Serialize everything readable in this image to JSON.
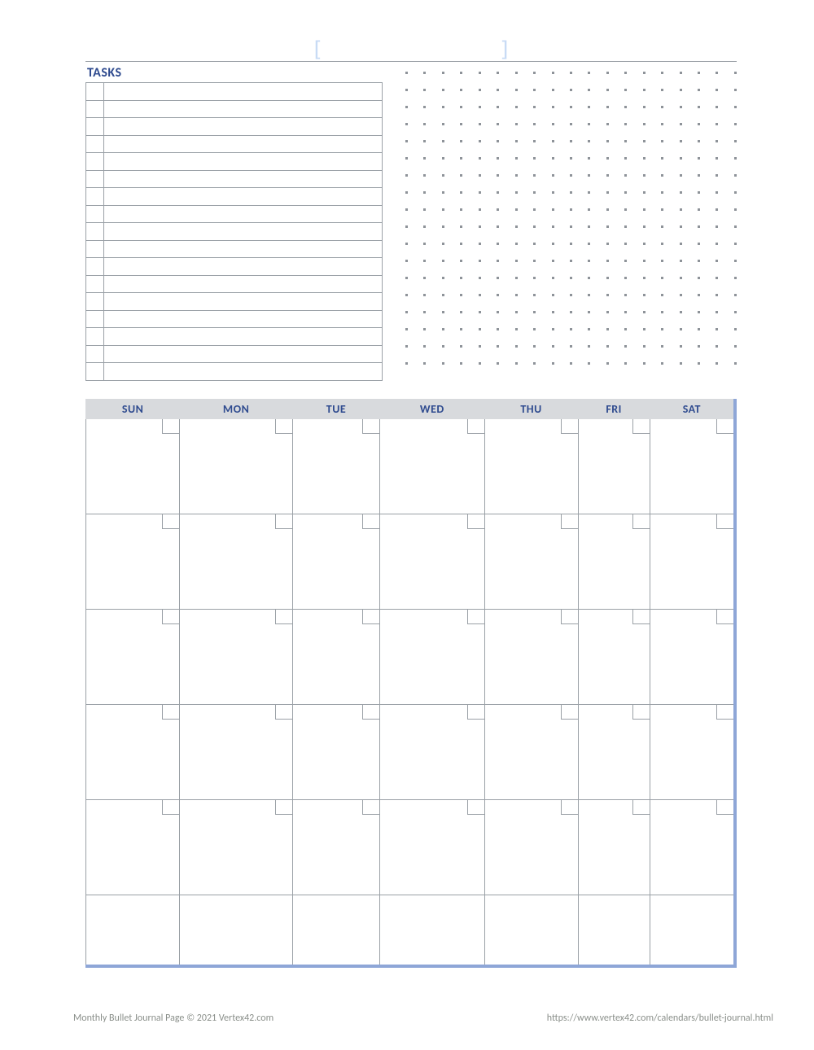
{
  "header": {
    "left_bracket": "[",
    "right_bracket": "]"
  },
  "tasks": {
    "heading": "TASKS",
    "row_count": 17
  },
  "dotgrid": {
    "rows": 18,
    "cols": 19
  },
  "calendar": {
    "day_headers": [
      "SUN",
      "MON",
      "TUE",
      "WED",
      "THU",
      "FRI",
      "SAT"
    ],
    "weeks": 6
  },
  "footer": {
    "left": "Monthly Bullet Journal Page © 2021 Vertex42.com",
    "right": "https://www.vertex42.com/calendars/bullet-journal.html"
  }
}
